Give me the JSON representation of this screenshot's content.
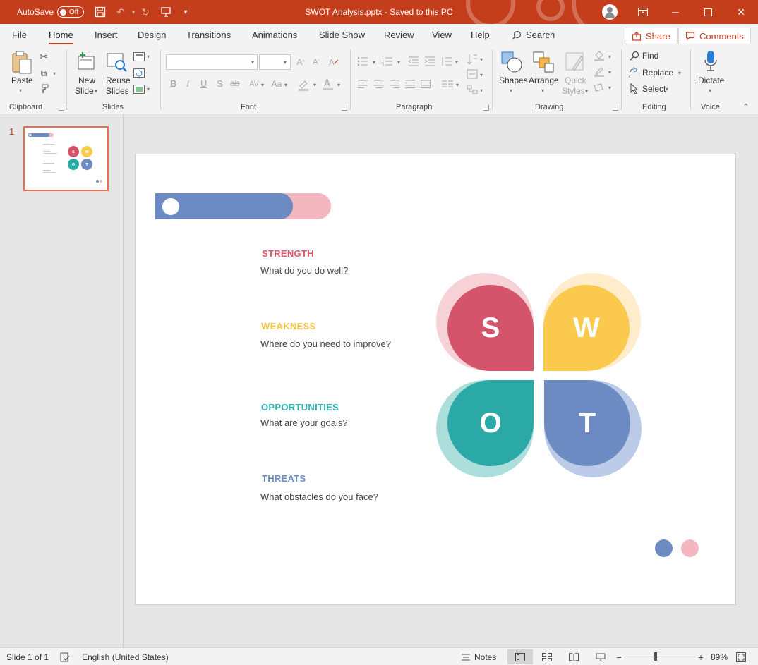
{
  "titlebar": {
    "autosave_label": "AutoSave",
    "autosave_state": "Off",
    "document_title": "SWOT Analysis.pptx  -  Saved to this PC"
  },
  "tabs": [
    "File",
    "Home",
    "Insert",
    "Design",
    "Transitions",
    "Animations",
    "Slide Show",
    "Review",
    "View",
    "Help"
  ],
  "active_tab": "Home",
  "search_label": "Search",
  "share_label": "Share",
  "comments_label": "Comments",
  "ribbon": {
    "clipboard": {
      "label": "Clipboard",
      "paste": "Paste"
    },
    "slides": {
      "label": "Slides",
      "new_slide_1": "New",
      "new_slide_2": "Slide",
      "reuse_1": "Reuse",
      "reuse_2": "Slides"
    },
    "font": {
      "label": "Font",
      "bold": "B",
      "italic": "I",
      "underline": "U",
      "shadow": "S",
      "strike": "ab"
    },
    "paragraph": {
      "label": "Paragraph"
    },
    "drawing": {
      "label": "Drawing",
      "shapes": "Shapes",
      "arrange": "Arrange",
      "quick_1": "Quick",
      "quick_2": "Styles"
    },
    "editing": {
      "label": "Editing",
      "find": "Find",
      "replace": "Replace",
      "select": "Select"
    },
    "voice": {
      "label": "Voice",
      "dictate": "Dictate"
    }
  },
  "thumbnail": {
    "number": "1"
  },
  "slide": {
    "items": [
      {
        "title": "STRENGTH",
        "body": "What do you do well?",
        "color": "#e0556d"
      },
      {
        "title": "WEAKNESS",
        "body": "Where do you need to improve?",
        "color": "#f5c542"
      },
      {
        "title": "OPPORTUNITIES",
        "body": "What are your goals?",
        "color": "#2bb3b0"
      },
      {
        "title": "THREATS",
        "body": "What obstacles do you face?",
        "color": "#6b8cc4"
      }
    ],
    "letters": {
      "s": "S",
      "w": "W",
      "o": "O",
      "t": "T"
    },
    "colors": {
      "s": "#d3546b",
      "w": "#fcc94f",
      "o": "#2aa9a6",
      "t": "#6c8bc2",
      "pink": "#f5b7bf",
      "blue": "#6c8bc2"
    }
  },
  "statusbar": {
    "slide_info": "Slide 1 of 1",
    "language": "English (United States)",
    "notes": "Notes",
    "zoom": "89%"
  },
  "accent": "#c43e1c"
}
